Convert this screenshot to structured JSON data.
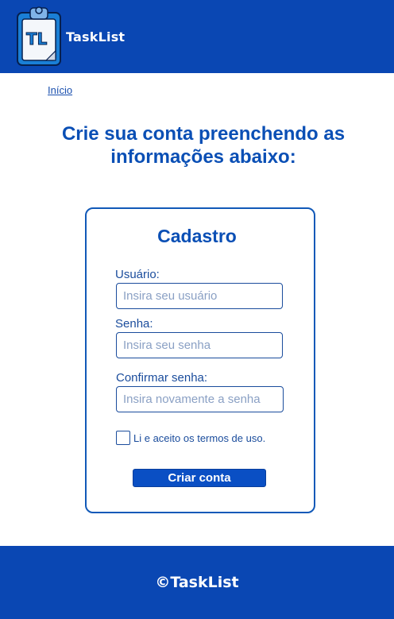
{
  "header": {
    "brand": "TaskList",
    "logo_letters": "TL"
  },
  "breadcrumb": {
    "home": "Início"
  },
  "headline": "Crie sua conta  preenchendo as informações abaixo:",
  "form": {
    "title": "Cadastro",
    "username_label": "Usuário:",
    "username_placeholder": "Insira seu usuário",
    "password_label": "Senha:",
    "password_placeholder": "Insira seu senha",
    "confirm_label": "Confirmar senha:",
    "confirm_placeholder": "Insira novamente a senha",
    "terms_label": "Li e aceito os termos de uso.",
    "terms_checked": false,
    "submit_label": "Criar conta"
  },
  "footer": {
    "copyright": "©TaskList"
  },
  "colors": {
    "brand_blue": "#0a47b3",
    "text_blue": "#0a4fb5",
    "button_blue": "#0a4fc4"
  }
}
